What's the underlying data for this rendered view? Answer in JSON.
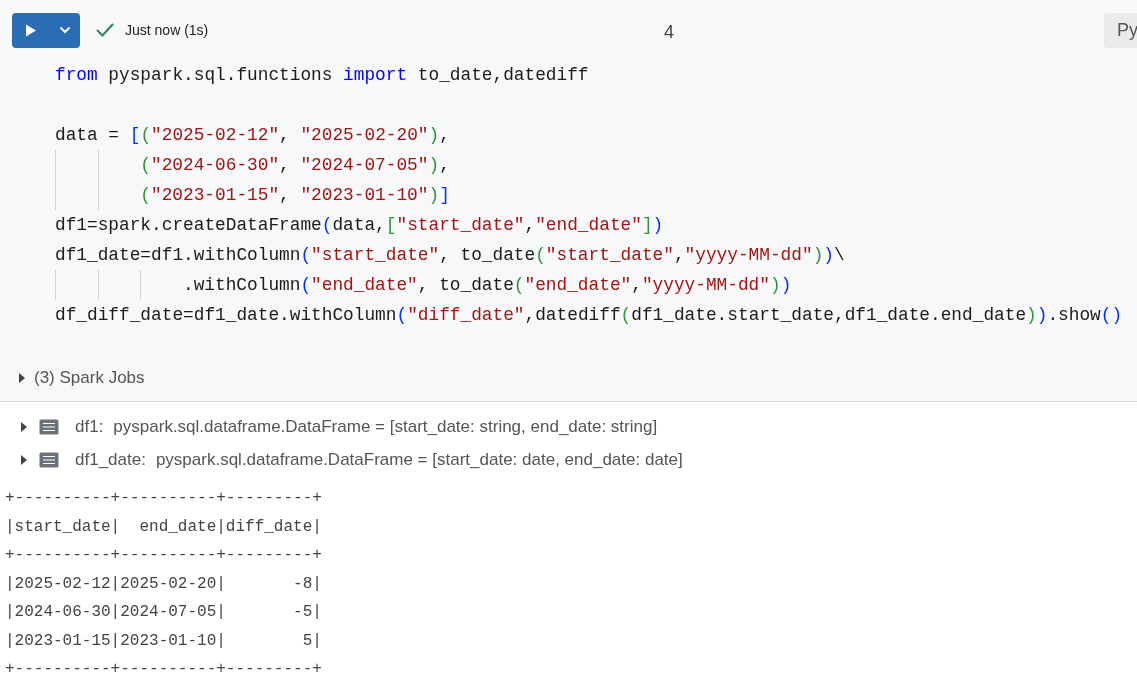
{
  "toolbar": {
    "status": "Just now (1s)",
    "succeeded": true,
    "cell_number": "4",
    "language": "Py"
  },
  "code": [
    {
      "kind": "code",
      "tokens": [
        {
          "kind": "keyword",
          "text": "from"
        },
        {
          "kind": "plain",
          "text": " pyspark.sql.functions "
        },
        {
          "kind": "keyword",
          "text": "import"
        },
        {
          "kind": "plain",
          "text": " to_date,datediff"
        }
      ]
    },
    {
      "kind": "blank"
    },
    {
      "kind": "code",
      "tokens": [
        {
          "kind": "plain",
          "text": "data = "
        },
        {
          "kind": "bracket1",
          "text": "["
        },
        {
          "kind": "bracket2",
          "text": "("
        },
        {
          "kind": "string",
          "text": "\"2025-02-12\""
        },
        {
          "kind": "plain",
          "text": ", "
        },
        {
          "kind": "string",
          "text": "\"2025-02-20\""
        },
        {
          "kind": "bracket2",
          "text": ")"
        },
        {
          "kind": "plain",
          "text": ","
        }
      ]
    },
    {
      "kind": "indent2",
      "tokens": [
        {
          "kind": "bracket2",
          "text": "("
        },
        {
          "kind": "string",
          "text": "\"2024-06-30\""
        },
        {
          "kind": "plain",
          "text": ", "
        },
        {
          "kind": "string",
          "text": "\"2024-07-05\""
        },
        {
          "kind": "bracket2",
          "text": ")"
        },
        {
          "kind": "plain",
          "text": ","
        }
      ]
    },
    {
      "kind": "indent2",
      "tokens": [
        {
          "kind": "bracket2",
          "text": "("
        },
        {
          "kind": "string",
          "text": "\"2023-01-15\""
        },
        {
          "kind": "plain",
          "text": ", "
        },
        {
          "kind": "string",
          "text": "\"2023-01-10\""
        },
        {
          "kind": "bracket2",
          "text": ")"
        },
        {
          "kind": "bracket1",
          "text": "]"
        }
      ]
    },
    {
      "kind": "code",
      "tokens": [
        {
          "kind": "plain",
          "text": "df1=spark.createDataFrame"
        },
        {
          "kind": "bracket1",
          "text": "("
        },
        {
          "kind": "plain",
          "text": "data,"
        },
        {
          "kind": "bracket2",
          "text": "["
        },
        {
          "kind": "string",
          "text": "\"start_date\""
        },
        {
          "kind": "plain",
          "text": ","
        },
        {
          "kind": "string",
          "text": "\"end_date\""
        },
        {
          "kind": "bracket2",
          "text": "]"
        },
        {
          "kind": "bracket1",
          "text": ")"
        }
      ]
    },
    {
      "kind": "code",
      "tokens": [
        {
          "kind": "plain",
          "text": "df1_date=df1.withColumn"
        },
        {
          "kind": "bracket1",
          "text": "("
        },
        {
          "kind": "string",
          "text": "\"start_date\""
        },
        {
          "kind": "plain",
          "text": ", to_date"
        },
        {
          "kind": "bracket2",
          "text": "("
        },
        {
          "kind": "string",
          "text": "\"start_date\""
        },
        {
          "kind": "plain",
          "text": ","
        },
        {
          "kind": "string",
          "text": "\"yyyy-MM-dd\""
        },
        {
          "kind": "bracket2",
          "text": ")"
        },
        {
          "kind": "bracket1",
          "text": ")"
        },
        {
          "kind": "plain",
          "text": "\\"
        }
      ]
    },
    {
      "kind": "indent3",
      "tokens": [
        {
          "kind": "plain",
          "text": ".withColumn"
        },
        {
          "kind": "bracket1",
          "text": "("
        },
        {
          "kind": "string",
          "text": "\"end_date\""
        },
        {
          "kind": "plain",
          "text": ", to_date"
        },
        {
          "kind": "bracket2",
          "text": "("
        },
        {
          "kind": "string",
          "text": "\"end_date\""
        },
        {
          "kind": "plain",
          "text": ","
        },
        {
          "kind": "string",
          "text": "\"yyyy-MM-dd\""
        },
        {
          "kind": "bracket2",
          "text": ")"
        },
        {
          "kind": "bracket1",
          "text": ")"
        }
      ]
    },
    {
      "kind": "code",
      "tokens": [
        {
          "kind": "plain",
          "text": "df_diff_date=df1_date.withColumn"
        },
        {
          "kind": "bracket1",
          "text": "("
        },
        {
          "kind": "string",
          "text": "\"diff_date\""
        },
        {
          "kind": "plain",
          "text": ",datediff"
        },
        {
          "kind": "bracket2",
          "text": "("
        },
        {
          "kind": "plain",
          "text": "df1_date.start_date,df1_date.end_date"
        },
        {
          "kind": "bracket2",
          "text": ")"
        },
        {
          "kind": "bracket1",
          "text": ")"
        },
        {
          "kind": "plain",
          "text": ".show"
        },
        {
          "kind": "bracket1",
          "text": "()"
        }
      ]
    }
  ],
  "spark_jobs": {
    "label": "(3) Spark Jobs",
    "expanded": false
  },
  "dataframes": [
    {
      "name": "df1:",
      "schema": "pyspark.sql.dataframe.DataFrame = [start_date: string, end_date: string]",
      "expanded": false
    },
    {
      "name": "df1_date:",
      "schema": "pyspark.sql.dataframe.DataFrame = [start_date: date, end_date: date]",
      "expanded": false
    }
  ],
  "output": [
    "+----------+----------+---------+",
    "|start_date|  end_date|diff_date|",
    "+----------+----------+---------+",
    "|2025-02-12|2025-02-20|       -8|",
    "|2024-06-30|2024-07-05|       -5|",
    "|2023-01-15|2023-01-10|        5|",
    "+----------+----------+---------+"
  ]
}
